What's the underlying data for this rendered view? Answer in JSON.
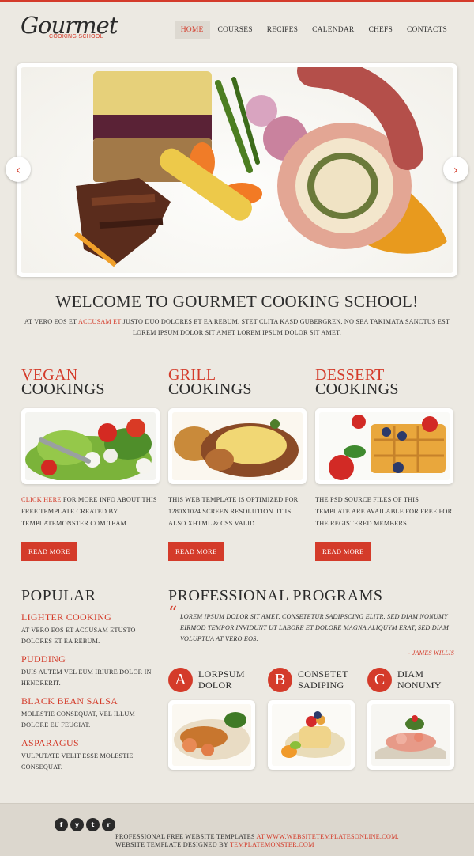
{
  "logo": {
    "title": "Gourmet",
    "subtitle": "COOKING SCHOOL"
  },
  "nav": {
    "items": [
      {
        "label": "HOME",
        "active": true
      },
      {
        "label": "COURSES"
      },
      {
        "label": "RECIPES"
      },
      {
        "label": "CALENDAR"
      },
      {
        "label": "CHEFS"
      },
      {
        "label": "CONTACTS"
      }
    ]
  },
  "slider": {
    "prev_icon": "chevron-left",
    "next_icon": "chevron-right"
  },
  "welcome": {
    "title": "WELCOME TO GOURMET COOKING SCHOOL!",
    "text_pre": "AT VERO EOS ET ",
    "text_link": "ACCUSAM ET",
    "text_post": " JUSTO DUO DOLORES ET EA REBUM. STET CLITA KASD GUBERGREN, NO SEA TAKIMATA SANCTUS EST LOREM IPSUM DOLOR SIT AMET LOREM IPSUM DOLOR SIT AMET."
  },
  "categories": [
    {
      "title1": "VEGAN",
      "title2": "COOKINGS",
      "link": "CLICK HERE",
      "text": " FOR MORE INFO ABOUT THIS FREE TEMPLATE CREATED BY TEMPLATEMONSTER.COM TEAM.",
      "button": "READ MORE"
    },
    {
      "title1": "GRILL",
      "title2": "COOKINGS",
      "link": "",
      "text": "THIS WEB TEMPLATE IS OPTIMIZED FOR 1280X1024 SCREEN RESOLUTION. IT IS ALSO XHTML & CSS VALID.",
      "button": "READ MORE"
    },
    {
      "title1": "DESSERT",
      "title2": "COOKINGS",
      "link": "",
      "text": "THE PSD SOURCE FILES OF THIS TEMPLATE ARE AVAILABLE FOR FREE FOR THE REGISTERED MEMBERS.",
      "button": "READ MORE"
    }
  ],
  "popular": {
    "title": "POPULAR",
    "items": [
      {
        "title": "LIGHTER COOKING",
        "text": "AT VERO EOS ET ACCUSAM ETUSTO DOLORES ET EA REBUM."
      },
      {
        "title": "PUDDING",
        "text": "DUIS AUTEM VEL EUM IRIURE DOLOR IN HENDRERIT."
      },
      {
        "title": "BLACK BEAN SALSA",
        "text": "MOLESTIE CONSEQUAT, VEL ILLUM DOLORE EU FEUGIAT."
      },
      {
        "title": "ASPARAGUS",
        "text": "VULPUTATE VELIT ESSE MOLESTIE CONSEQUAT."
      }
    ]
  },
  "programs": {
    "title": "PROFESSIONAL PROGRAMS",
    "quote": "LOREM IPSUM DOLOR SIT AMET, CONSETETUR SADIPSCING ELITR, SED DIAM NONUMY EIRMOD TEMPOR INVIDUNT UT LABORE ET DOLORE MAGNA ALIQUYM ERAT, SED DIAM VOLUPTUA AT VERO EOS.",
    "author": "- JAMES WILLIS",
    "items": [
      {
        "letter": "A",
        "line1": "LORPSUM",
        "line2": "DOLOR"
      },
      {
        "letter": "B",
        "line1": "CONSETET",
        "line2": "SADIPING"
      },
      {
        "letter": "C",
        "line1": "DIAM",
        "line2": "NONUMY"
      }
    ]
  },
  "footer": {
    "social": [
      "f",
      "y",
      "t",
      "r"
    ],
    "line1_pre": "PROFESSIONAL FREE WEBSITE TEMPLATES ",
    "line1_link": "AT WWW.WEBSITETEMPLATESONLINE.COM.",
    "line2_pre": "WEBSITE TEMPLATE DESIGNED BY ",
    "line2_link": "TEMPLATEMONSTER.COM"
  },
  "colors": {
    "accent": "#d43b2a",
    "background": "#ece9e2",
    "text": "#2a2a2a"
  }
}
